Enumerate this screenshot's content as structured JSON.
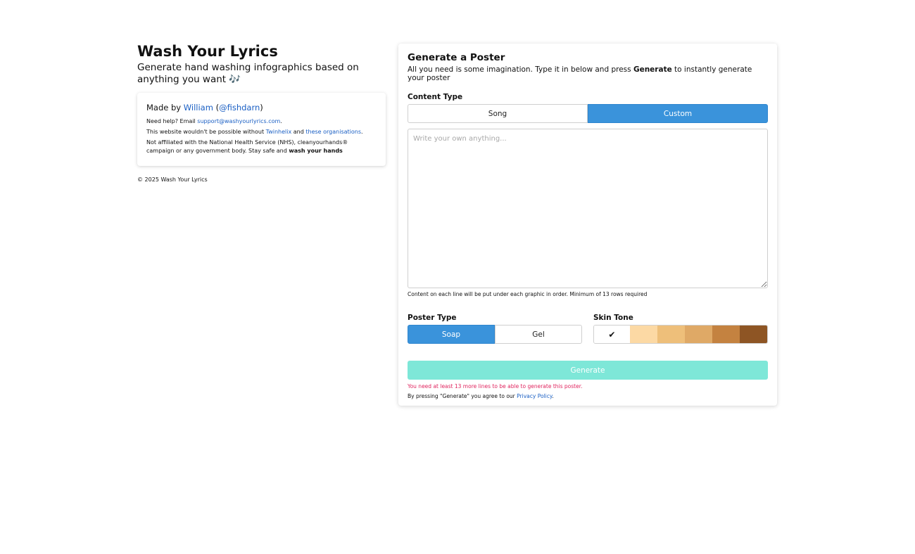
{
  "site": {
    "title": "Wash Your Lyrics",
    "subtitle": "Generate hand washing infographics based on anything you want 🎶"
  },
  "info": {
    "made_by_prefix": "Made by ",
    "author_name": "William",
    "author_open": " (",
    "author_handle": "@fishdarn",
    "author_close": ")",
    "help_prefix": "Need help? Email ",
    "help_email": "support@washyourlyrics.com",
    "help_suffix": ".",
    "thanks_prefix": "This website wouldn't be possible without ",
    "thanks_link1": "Twinhelix",
    "thanks_and": " and ",
    "thanks_link2": "these organisations",
    "thanks_suffix": ".",
    "disclaimer": "Not affiliated with the National Health Service (NHS), cleanyourhands® campaign or any government body. Stay safe and ",
    "disclaimer_bold": "wash your hands"
  },
  "footer": {
    "copyright": "© 2025 Wash Your Lyrics"
  },
  "panel": {
    "title": "Generate a Poster",
    "desc_prefix": "All you need is some imagination. Type it in below and press ",
    "desc_bold": "Generate",
    "desc_suffix": " to instantly generate your poster",
    "content_type_label": "Content Type",
    "content_types": [
      {
        "label": "Song",
        "active": false
      },
      {
        "label": "Custom",
        "active": true
      }
    ],
    "textarea_placeholder": "Write your own anything...",
    "hint": "Content on each line will be put under each graphic in order. Minimum of 13 rows required",
    "poster_type_label": "Poster Type",
    "poster_types": [
      {
        "label": "Soap",
        "active": true
      },
      {
        "label": "Gel",
        "active": false
      }
    ],
    "skin_tone_label": "Skin Tone",
    "skin_tones": [
      "#ffffff",
      "#fcd9a4",
      "#eebf7a",
      "#dfa966",
      "#c48240",
      "#8e5524"
    ],
    "selected_mark": "✔",
    "generate_label": "Generate",
    "error": "You need at least 13 more lines to be able to generate this poster.",
    "agree_prefix": "By pressing \"Generate\" you agree to our ",
    "agree_link": "Privacy Policy",
    "agree_suffix": "."
  }
}
